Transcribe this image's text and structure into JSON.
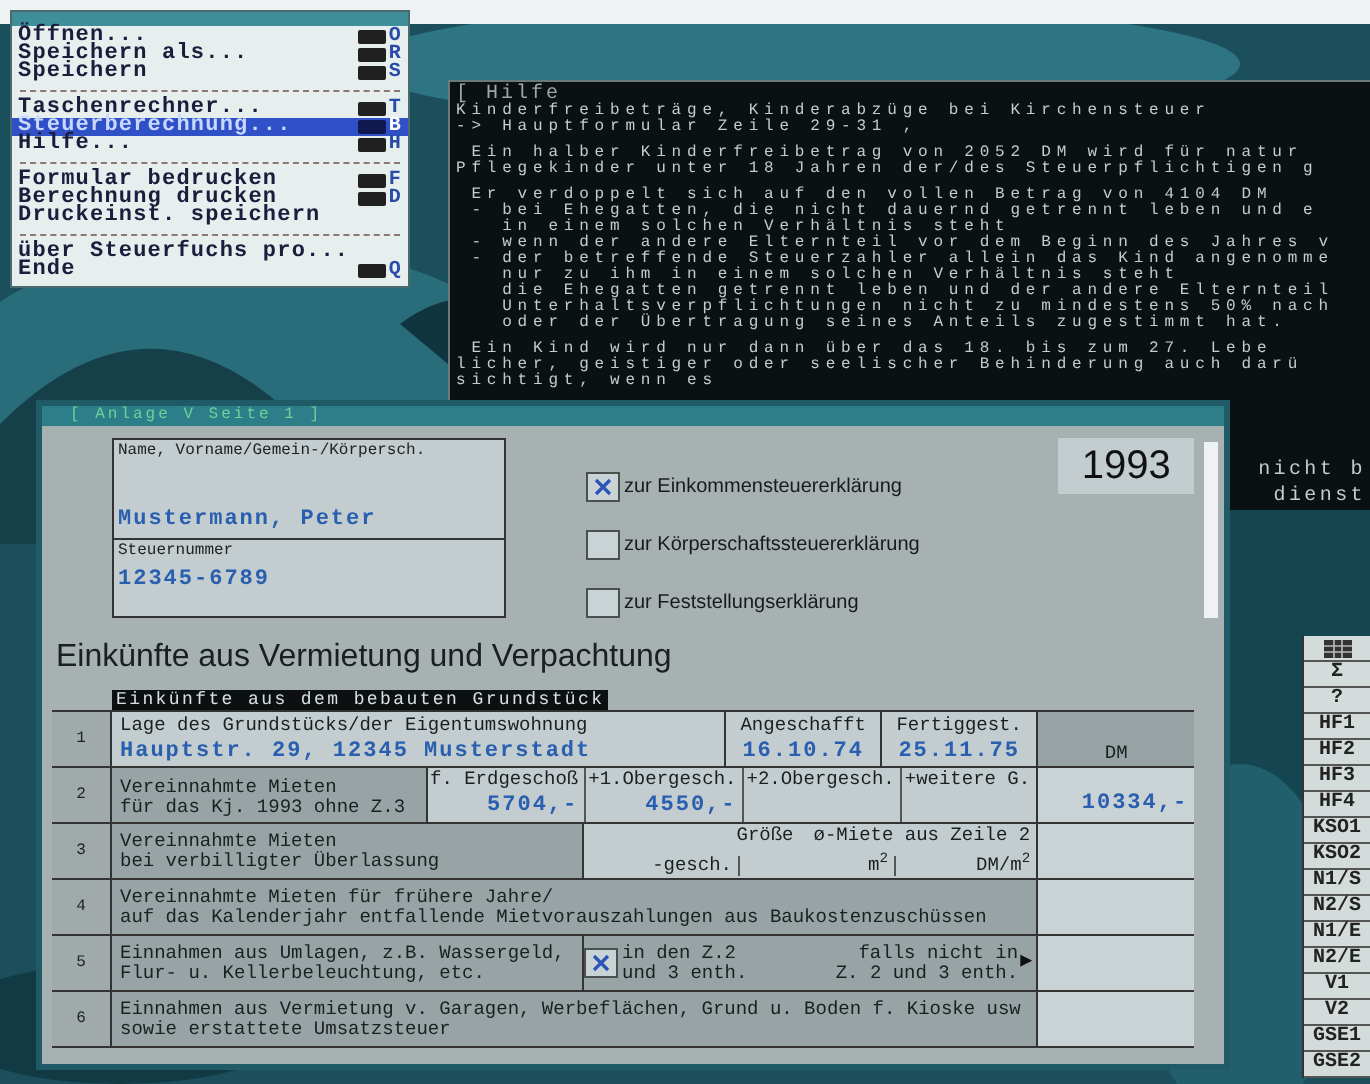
{
  "menu": {
    "items": [
      {
        "kind": "item",
        "label": "Öffnen...",
        "shortcut": "O",
        "selected": false
      },
      {
        "kind": "item",
        "label": "Speichern als...",
        "shortcut": "R",
        "selected": false
      },
      {
        "kind": "item",
        "label": "Speichern",
        "shortcut": "S",
        "selected": false
      },
      {
        "kind": "separator"
      },
      {
        "kind": "item",
        "label": "Taschenrechner...",
        "shortcut": "T",
        "selected": false
      },
      {
        "kind": "item",
        "label": "Steuerberechnung...",
        "shortcut": "B",
        "selected": true
      },
      {
        "kind": "item",
        "label": "Hilfe...",
        "shortcut": "H",
        "selected": false
      },
      {
        "kind": "separator"
      },
      {
        "kind": "item",
        "label": "Formular bedrucken",
        "shortcut": "F",
        "selected": false
      },
      {
        "kind": "item",
        "label": "Berechnung drucken",
        "shortcut": "D",
        "selected": false
      },
      {
        "kind": "item",
        "label": "Druckeinst. speichern",
        "selected": false
      },
      {
        "kind": "separator"
      },
      {
        "kind": "item",
        "label": "über Steuerfuchs pro...",
        "selected": false
      },
      {
        "kind": "item",
        "label": "Ende",
        "shortcut": "Q",
        "selected": false
      }
    ]
  },
  "help": {
    "title": "[ Hilfe",
    "paragraphs": [
      [
        "Kinderfreibeträge, Kinderabzüge bei Kirchensteuer",
        "-> Hauptformular Zeile 29-31 ,"
      ],
      [
        " Ein halber Kinderfreibetrag von 2052 DM wird für natur",
        "Pflegekinder unter 18 Jahren der/des Steuerpflichtigen g"
      ],
      [
        " Er verdoppelt sich auf den vollen Betrag von 4104 DM",
        " - bei Ehegatten, die nicht dauernd getrennt leben und e",
        "   in einem solchen Verhältnis steht",
        " - wenn der andere Elternteil vor dem Beginn des Jahres v",
        " - der betreffende Steuerzahler allein das Kind angenomme",
        "   nur zu ihm in einem solchen Verhältnis steht",
        "   die Ehegatten getrennt leben und der andere Elternteil",
        "   Unterhaltsverpflichtungen nicht zu mindestens 50% nach",
        "   oder der Übertragung seines Anteils zugestimmt hat."
      ],
      [
        " Ein Kind wird nur dann über das 18. bis zum 27. Lebe",
        "licher, geistiger oder seelischer Behinderung auch darü",
        "sichtigt, wenn es"
      ]
    ],
    "covered_lines": [
      "nicht b",
      "dienst"
    ]
  },
  "form": {
    "title": "[ Anlage V Seite 1 ]",
    "name_label": "Name, Vorname/Gemein-/Körpersch.",
    "name": "Mustermann, Peter",
    "tax_number_label": "Steuernummer",
    "tax_number": "12345-6789",
    "declarations": [
      {
        "label": "zur Einkommensteuererklärung",
        "checked": true
      },
      {
        "label": "zur Körperschaftssteuererklärung",
        "checked": false
      },
      {
        "label": "zur Feststellungserklärung",
        "checked": false
      }
    ],
    "year": "1993",
    "heading": "Einkünfte aus Vermietung und Verpachtung",
    "section": "Einkünfte aus dem bebauten Grundstück",
    "rows": [
      {
        "number": "1",
        "kind": "location",
        "label": "Lage des Grundstücks/der Eigentumswohnung",
        "value": "Hauptstr. 29, 12345 Musterstadt",
        "acquired_label": "Angeschafft",
        "acquired": "16.10.74",
        "completed_label": "Fertiggest.",
        "completed": "25.11.75",
        "amount_header": "DM"
      },
      {
        "number": "2",
        "kind": "rents",
        "label_lines": [
          "Vereinnahmte Mieten",
          "für das Kj. 1993 ohne Z.3"
        ],
        "floors": [
          {
            "label": "f. Erdgeschoß",
            "value": "5704,-"
          },
          {
            "label": "+1.Obergesch.",
            "value": "4550,-"
          },
          {
            "label": "+2.Obergesch."
          },
          {
            "label": "+weitere G."
          }
        ],
        "amount": "10334,-"
      },
      {
        "number": "3",
        "kind": "reduced",
        "label_lines": [
          "Vereinnahmte Mieten",
          "bei verbilligter Überlassung"
        ],
        "size_label": "Größe",
        "avg_label": "ø-Miete aus Zeile 2",
        "units": [
          "-gesch.",
          "m$^{2}$",
          "DM/m$^{2}$"
        ]
      },
      {
        "number": "4",
        "kind": "text",
        "label_lines": [
          "Vereinnahmte Mieten für frühere Jahre/",
          "auf das Kalenderjahr entfallende Mietvorauszahlungen aus Baukostenzuschüssen"
        ]
      },
      {
        "number": "5",
        "kind": "levies",
        "label_lines": [
          "Einnahmen aus Umlagen, z.B. Wassergeld,",
          "Flur- u. Kellerbeleuchtung, etc."
        ],
        "included": {
          "checked": true,
          "lines": [
            "in den Z.2",
            "und 3 enth."
          ]
        },
        "excluded_lines": [
          "falls nicht in",
          "Z. 2 und 3 enth."
        ],
        "arrow": "▶"
      },
      {
        "number": "6",
        "kind": "text",
        "label_lines": [
          "Einnahmen aus Vermietung v. Garagen, Werbeflächen, Grund u. Boden f. Kioske usw",
          "sowie erstattete Umsatzsteuer"
        ]
      }
    ]
  },
  "toolbar": {
    "buttons": [
      "Σ",
      "?",
      "HF1",
      "HF2",
      "HF3",
      "HF4",
      "KSO1",
      "KSO2",
      "N1/S",
      "N2/S",
      "N1/E",
      "N2/E",
      "V1",
      "V2",
      "GSE1",
      "GSE2"
    ]
  }
}
